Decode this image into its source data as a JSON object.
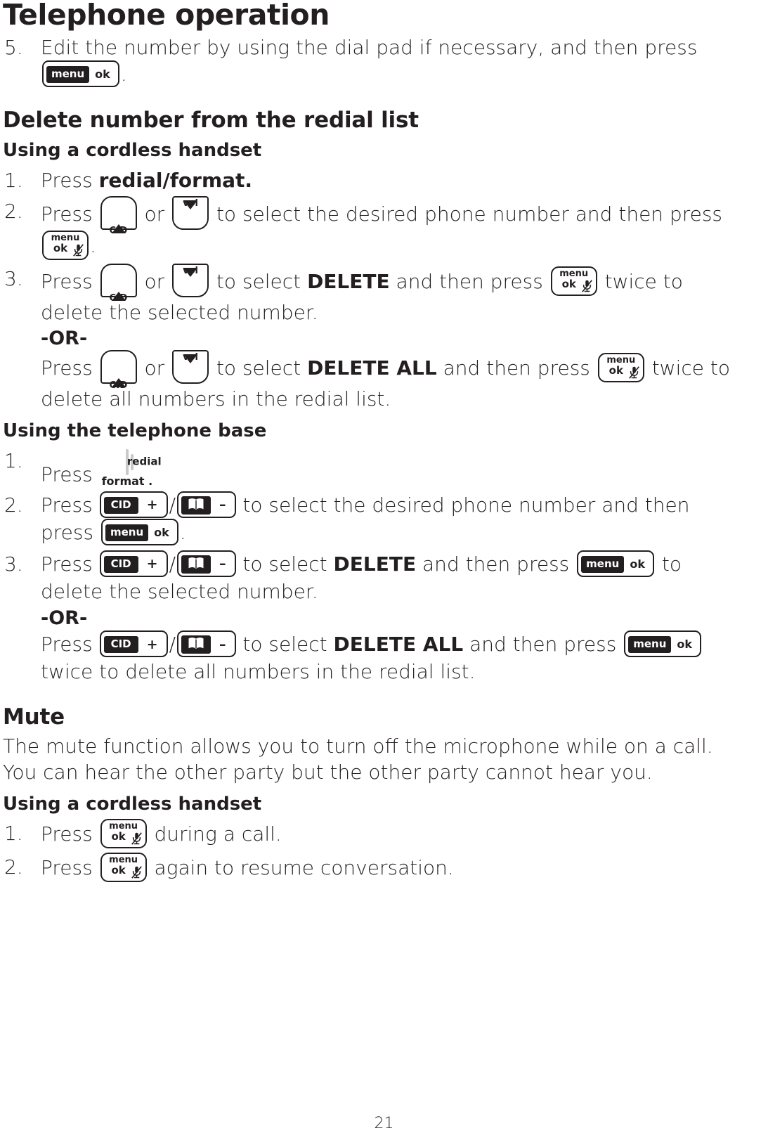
{
  "document": {
    "chapter_title": "Telephone operation",
    "page_number": "21"
  },
  "keys": {
    "menu_ok": {
      "menu": "menu",
      "ok": "ok",
      "name": "menu-ok-key"
    },
    "handset_cid": {
      "label": "CID",
      "glyph": "triangle-up-plus"
    },
    "handset_vol": {
      "label": "vol",
      "glyph": "triangle-down"
    },
    "handset_menu_ok": {
      "top": "menu",
      "bottom": "ok",
      "glyph": "mute-microphone"
    },
    "base_redial": {
      "label": "redial",
      "sublabel": "format ."
    },
    "base_cid": {
      "label": "CID",
      "sign": "+"
    },
    "base_phonebook": {
      "label": "phonebook-book-icon",
      "sign": "–"
    }
  },
  "continued_step": {
    "number": "5.",
    "text_before": "Edit the number by using the dial pad if necessary, and then press",
    "text_after": "."
  },
  "delete_section": {
    "title": "Delete number from the redial list",
    "handset": {
      "subtitle": "Using a cordless handset",
      "steps": [
        {
          "number": "1.",
          "parts": [
            {
              "t": "text",
              "v": "Press "
            },
            {
              "t": "bold",
              "v": "redial/format."
            }
          ]
        },
        {
          "number": "2.",
          "parts": [
            {
              "t": "text",
              "v": "Press "
            },
            {
              "t": "key",
              "v": "handset_cid"
            },
            {
              "t": "text",
              "v": " or "
            },
            {
              "t": "key",
              "v": "handset_vol"
            },
            {
              "t": "text",
              "v": " to select the desired phone number and then press "
            },
            {
              "t": "key",
              "v": "handset_menu_ok"
            },
            {
              "t": "text",
              "v": "."
            }
          ]
        },
        {
          "number": "3.",
          "parts": [
            {
              "t": "text",
              "v": "Press "
            },
            {
              "t": "key",
              "v": "handset_cid"
            },
            {
              "t": "text",
              "v": " or "
            },
            {
              "t": "key",
              "v": "handset_vol"
            },
            {
              "t": "text",
              "v": " to select "
            },
            {
              "t": "bold",
              "v": "DELETE"
            },
            {
              "t": "text",
              "v": " and then press "
            },
            {
              "t": "key",
              "v": "handset_menu_ok"
            },
            {
              "t": "text",
              "v": " twice to delete the selected number."
            },
            {
              "t": "or",
              "v": "-OR-"
            },
            {
              "t": "text",
              "v": "Press "
            },
            {
              "t": "key",
              "v": "handset_cid"
            },
            {
              "t": "text",
              "v": " or "
            },
            {
              "t": "key",
              "v": "handset_vol"
            },
            {
              "t": "text",
              "v": " to select "
            },
            {
              "t": "bold",
              "v": "DELETE ALL"
            },
            {
              "t": "text",
              "v": " and then press "
            },
            {
              "t": "key",
              "v": "handset_menu_ok"
            },
            {
              "t": "text",
              "v": " twice to delete all numbers in the redial list."
            }
          ]
        }
      ]
    },
    "base": {
      "subtitle": "Using the telephone base",
      "steps": [
        {
          "number": "1.",
          "parts": [
            {
              "t": "text",
              "v": "Press "
            },
            {
              "t": "key",
              "v": "base_redial"
            }
          ]
        },
        {
          "number": "2.",
          "parts": [
            {
              "t": "text",
              "v": "Press "
            },
            {
              "t": "key",
              "v": "base_cid"
            },
            {
              "t": "slash",
              "v": "/"
            },
            {
              "t": "key",
              "v": "base_phonebook"
            },
            {
              "t": "text",
              "v": " to select the desired phone number and then press "
            },
            {
              "t": "key",
              "v": "menu_ok"
            },
            {
              "t": "text",
              "v": "."
            }
          ]
        },
        {
          "number": "3.",
          "parts": [
            {
              "t": "text",
              "v": "Press "
            },
            {
              "t": "key",
              "v": "base_cid"
            },
            {
              "t": "slash",
              "v": "/"
            },
            {
              "t": "key",
              "v": "base_phonebook"
            },
            {
              "t": "text",
              "v": " to select "
            },
            {
              "t": "bold",
              "v": "DELETE"
            },
            {
              "t": "text",
              "v": " and then press "
            },
            {
              "t": "key",
              "v": "menu_ok"
            },
            {
              "t": "text",
              "v": " to delete the selected number."
            },
            {
              "t": "or",
              "v": "-OR-"
            },
            {
              "t": "text",
              "v": "Press "
            },
            {
              "t": "key",
              "v": "base_cid"
            },
            {
              "t": "slash",
              "v": "/"
            },
            {
              "t": "key",
              "v": "base_phonebook"
            },
            {
              "t": "text",
              "v": " to select "
            },
            {
              "t": "bold",
              "v": "DELETE ALL"
            },
            {
              "t": "text",
              "v": " and then press "
            },
            {
              "t": "key",
              "v": "menu_ok"
            },
            {
              "t": "text",
              "v": " twice to delete all numbers in the redial list."
            }
          ]
        }
      ]
    }
  },
  "mute_section": {
    "title": "Mute",
    "description": "The mute function allows you to turn off the microphone while on a call. You can hear the other party but the other party cannot hear you.",
    "handset": {
      "subtitle": "Using a cordless handset",
      "steps": [
        {
          "number": "1.",
          "parts": [
            {
              "t": "text",
              "v": "Press "
            },
            {
              "t": "key",
              "v": "handset_menu_ok"
            },
            {
              "t": "text",
              "v": " during a call."
            }
          ]
        },
        {
          "number": "2.",
          "parts": [
            {
              "t": "text",
              "v": "Press "
            },
            {
              "t": "key",
              "v": "handset_menu_ok"
            },
            {
              "t": "text",
              "v": " again to resume conversation."
            }
          ]
        }
      ]
    }
  }
}
